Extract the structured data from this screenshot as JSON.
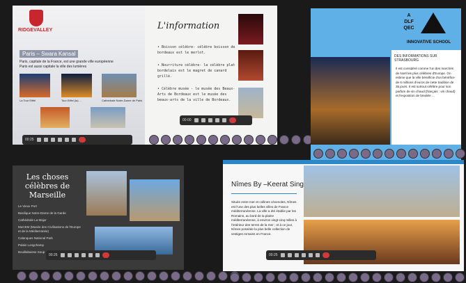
{
  "slides": {
    "paris": {
      "logo_text": "RIDGEVALLEY",
      "title": "Paris – Swara Kansal",
      "bullets": [
        "Paris, capitale de la France, est une grande ville européenne",
        "Paris est aussi capitale la ville des lumières"
      ],
      "captions": [
        "La Tour Eiffel",
        "Tour Eiffel (la) …",
        "Cathédrale Notre-Dame de Paris"
      ],
      "toolbar_time": "00:25"
    },
    "information": {
      "title": "L'information",
      "bullets": [
        "• Boisson célèbre- célèbre boisson de bordeaux est le merlot.",
        "• Nourriture célèbre- la célèbre plat bordelais est le magret de canard grillé.",
        "• Célèbre musée - le musée des Beaux-Arts de Bordeaux est le musée des beaux-arts de la ville de Bordeaux."
      ],
      "toolbar_time": "00:00"
    },
    "strasbourg": {
      "logo_lines": [
        "A",
        "DLF",
        "QEC",
        "INNOVATIVE SCHOOL"
      ],
      "heading": "DES INFORMATIONS SUR STRASBOURG",
      "body": "Il est considéré comme l'un des marchés de Noël les plus célèbres d'Europe. On estime que la ville bénéficie d'un bénéfice de 6 millions d'euros de cette tradition de 35 jours. Il est surtout célèbre pour son parfum de vin chaud (français : vin chaud) et l'exposition de bredele ..."
    },
    "marseille": {
      "title": "Les choses célèbres de Marseille",
      "items": [
        "Le Vieux Port",
        "Basilique Notre-Dame de la Garde",
        "Cathédrale La Major",
        "MuCEM (Musée des Civilisations de l'Europe et de la Méditerranée)",
        "Calanques National Park",
        "Palais Longchamp",
        "Bouillabaisse Soup"
      ],
      "toolbar_time": "00:26"
    },
    "nimes": {
      "title": "Nîmes By –Keerat Singh",
      "body": "Située entre mer et collines cévenoles, Nîmes est l'une des plus belles villes de France méditerranéenne. La ville a été établie par les Romains, au bord de la plaine méditerranéenne, à environ vingt-cinq milles à l'intérieur des terres de la mer ; et à ce jour, Nîmes possède la plus belle collection de vestiges romains en France.",
      "toolbar_time": "00:25"
    }
  }
}
